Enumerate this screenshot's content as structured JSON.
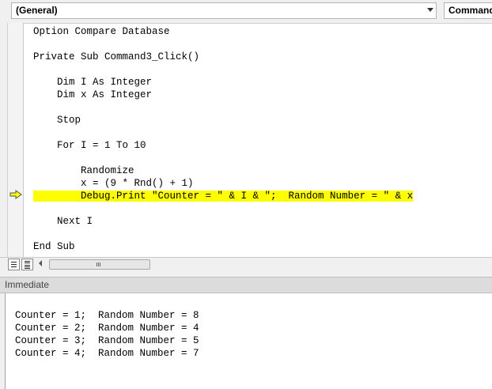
{
  "toolbar": {
    "object_dropdown": "(General)",
    "procedure_dropdown": "Command"
  },
  "code": {
    "lines": [
      "Option Compare Database",
      "",
      "Private Sub Command3_Click()",
      "",
      "    Dim I As Integer",
      "    Dim x As Integer",
      "",
      "    Stop",
      "",
      "    For I = 1 To 10",
      "",
      "        Randomize",
      "        x = (9 * Rnd() + 1)",
      "        Debug.Print \"Counter = \" & I & \";  Random Number = \" & x",
      "",
      "    Next I",
      "",
      "End Sub"
    ],
    "highlighted_line_index": 13,
    "highlight_color": "#ffff00"
  },
  "immediate": {
    "title": "Immediate",
    "lines": [
      "",
      "Counter = 1;  Random Number = 8",
      "Counter = 2;  Random Number = 4",
      "Counter = 3;  Random Number = 5",
      "Counter = 4;  Random Number = 7"
    ]
  },
  "icons": {
    "execution_arrow": "execution-pointer-icon",
    "procedure_view": "procedure-view-icon",
    "full_module_view": "full-module-view-icon"
  }
}
